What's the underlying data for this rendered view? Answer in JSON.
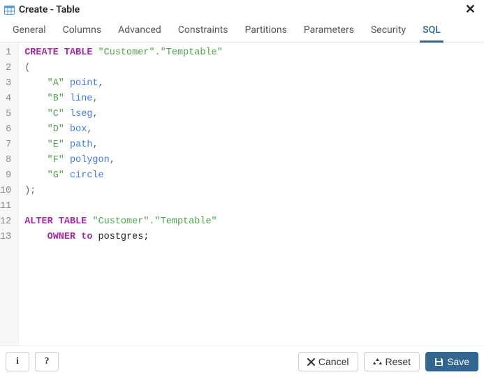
{
  "title": "Create - Table",
  "tabs": [
    "General",
    "Columns",
    "Advanced",
    "Constraints",
    "Partitions",
    "Parameters",
    "Security",
    "SQL"
  ],
  "selected_tab": "SQL",
  "line_numbers": [
    "1",
    "2",
    "3",
    "4",
    "5",
    "6",
    "7",
    "8",
    "9",
    "10",
    "11",
    "12",
    "13"
  ],
  "sql": {
    "create_kw": "CREATE TABLE ",
    "tbl_full": "\"Customer\".\"Temptable\"",
    "open_paren": "(",
    "cols": [
      {
        "name": "\"A\"",
        "type": "point",
        "comma": ","
      },
      {
        "name": "\"B\"",
        "type": "line",
        "comma": ","
      },
      {
        "name": "\"C\"",
        "type": "lseg",
        "comma": ","
      },
      {
        "name": "\"D\"",
        "type": "box",
        "comma": ","
      },
      {
        "name": "\"E\"",
        "type": "path",
        "comma": ","
      },
      {
        "name": "\"F\"",
        "type": "polygon",
        "comma": ","
      },
      {
        "name": "\"G\"",
        "type": "circle",
        "comma": ""
      }
    ],
    "close_paren": ");",
    "alter_kw": "ALTER TABLE ",
    "owner_kw": "OWNER to ",
    "owner_val": "postgres;",
    "indent4": "    ",
    "sp": " "
  },
  "buttons": {
    "info": "i",
    "help": "?",
    "cancel": "Cancel",
    "reset": "Reset",
    "save": "Save"
  }
}
